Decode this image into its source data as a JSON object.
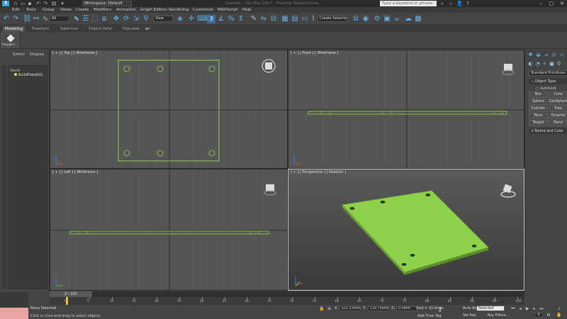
{
  "titlebar": {
    "logo": "3",
    "workspace": "Workspace: Default",
    "title": "Untitled - 3ds Max 2017 - Flooring Stand24.max",
    "search_placeholder": "Type a keyword or phrase"
  },
  "menus": [
    "Edit",
    "Tools",
    "Group",
    "Views",
    "Create",
    "Modifiers",
    "Animation",
    "Graph Editors",
    "Rendering",
    "Customize",
    "MAXScript",
    "Help"
  ],
  "toolbar": {
    "selection_filter": "All",
    "reference_coord": "View",
    "create_selection_set": "Create Selection Se"
  },
  "ribbon": {
    "tabs": [
      "Modeling",
      "Freeform",
      "Selection",
      "Object Paint",
      "Populate"
    ],
    "active_tab": "Modeling",
    "polygon_button": "Polygon..."
  },
  "scene_explorer": {
    "tabs": [
      "Select",
      "Display"
    ],
    "root": "World",
    "items": [
      "BuildPlate001"
    ]
  },
  "viewports": {
    "top": "[ + ] [ Top ] [ Wireframe ]",
    "front": "[ + ] [ Front ] [ Wireframe ]",
    "left": "[ + ] [ Left ] [ Wireframe ]",
    "perspective": "[ + ] [ Perspective ] [ Realistic ]",
    "object_color": "#8ed14a"
  },
  "command_panel": {
    "primitives_dropdown": "Standard Primitives",
    "object_type_header": "Object Type",
    "autogrid_label": "AutoGrid",
    "object_buttons": [
      "Box",
      "Cone",
      "Sphere",
      "GeoSphere",
      "Cylinder",
      "Tube",
      "Torus",
      "Pyramid",
      "Teapot",
      "Plane"
    ],
    "name_color_header": "Name and Color"
  },
  "timeline": {
    "slider_text": "0 / 100",
    "current_frame": 0,
    "total_frames": 100,
    "ticks": [
      0,
      5,
      10,
      15,
      20,
      25,
      30,
      35,
      40,
      45,
      50,
      55,
      60,
      65,
      70,
      75,
      80,
      85,
      90,
      95,
      100
    ]
  },
  "statusbar": {
    "selection_info": "None Selected",
    "prompt": "Click or click-and-drag to select objects",
    "x_label": "X:",
    "x_value": "101.234mm",
    "y_label": "Y:",
    "y_value": "126.766mm",
    "z_label": "Z:",
    "z_value": "0.0mm",
    "grid": "Grid = 10.0mm",
    "add_time_tag": "Add Time Tag",
    "auto_key": "Auto Key",
    "set_key": "Set Key",
    "selected_dropdown": "Selected",
    "key_filters": "Key Filters...",
    "frame": "0"
  }
}
